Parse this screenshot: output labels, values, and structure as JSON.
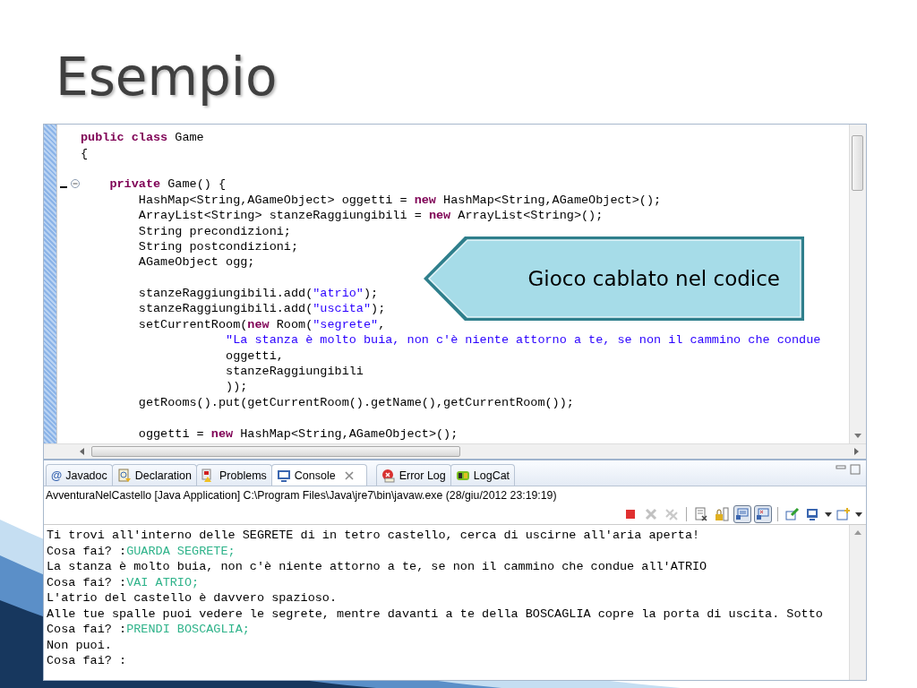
{
  "slide": {
    "title": "Esempio"
  },
  "editor": {
    "lines": [
      {
        "kind": "code",
        "segments": [
          {
            "kind": "keyword",
            "text": "public class"
          },
          {
            "kind": "plain",
            "text": " Game"
          }
        ]
      },
      {
        "kind": "code",
        "segments": [
          {
            "kind": "plain",
            "text": "{"
          }
        ]
      },
      {
        "kind": "blank"
      },
      {
        "kind": "code",
        "expanded": true,
        "caret": true,
        "segments": [
          {
            "kind": "keyword",
            "text": "    private"
          },
          {
            "kind": "plain",
            "text": " Game() {"
          }
        ]
      },
      {
        "kind": "code",
        "segments": [
          {
            "kind": "plain",
            "text": "        HashMap<String,AGameObject> oggetti = "
          },
          {
            "kind": "keyword",
            "text": "new"
          },
          {
            "kind": "plain",
            "text": " HashMap<String,AGameObject>();"
          }
        ]
      },
      {
        "kind": "code",
        "segments": [
          {
            "kind": "plain",
            "text": "        ArrayList<String> stanzeRaggiungibili = "
          },
          {
            "kind": "keyword",
            "text": "new"
          },
          {
            "kind": "plain",
            "text": " ArrayList<String>();"
          }
        ]
      },
      {
        "kind": "code",
        "segments": [
          {
            "kind": "plain",
            "text": "        String precondizioni;"
          }
        ]
      },
      {
        "kind": "code",
        "segments": [
          {
            "kind": "plain",
            "text": "        String postcondizioni;"
          }
        ]
      },
      {
        "kind": "code",
        "segments": [
          {
            "kind": "plain",
            "text": "        AGameObject ogg;"
          }
        ]
      },
      {
        "kind": "blank"
      },
      {
        "kind": "code",
        "segments": [
          {
            "kind": "plain",
            "text": "        stanzeRaggiungibili.add("
          },
          {
            "kind": "string",
            "text": "\"atrio\""
          },
          {
            "kind": "plain",
            "text": ");"
          }
        ]
      },
      {
        "kind": "code",
        "segments": [
          {
            "kind": "plain",
            "text": "        stanzeRaggiungibili.add("
          },
          {
            "kind": "string",
            "text": "\"uscita\""
          },
          {
            "kind": "plain",
            "text": ");"
          }
        ]
      },
      {
        "kind": "code",
        "segments": [
          {
            "kind": "plain",
            "text": "        setCurrentRoom("
          },
          {
            "kind": "keyword",
            "text": "new"
          },
          {
            "kind": "plain",
            "text": " Room("
          },
          {
            "kind": "string",
            "text": "\"segrete\""
          },
          {
            "kind": "plain",
            "text": ","
          }
        ]
      },
      {
        "kind": "code",
        "segments": [
          {
            "kind": "string",
            "text": "                    \"La stanza è molto buia, non c'è niente attorno a te, se non il cammino che condue"
          }
        ]
      },
      {
        "kind": "code",
        "segments": [
          {
            "kind": "plain",
            "text": "                    oggetti,"
          }
        ]
      },
      {
        "kind": "code",
        "segments": [
          {
            "kind": "plain",
            "text": "                    stanzeRaggiungibili"
          }
        ]
      },
      {
        "kind": "code",
        "segments": [
          {
            "kind": "plain",
            "text": "                    ));"
          }
        ]
      },
      {
        "kind": "code",
        "segments": [
          {
            "kind": "plain",
            "text": "        getRooms().put(getCurrentRoom().getName(),getCurrentRoom());"
          }
        ]
      },
      {
        "kind": "blank"
      },
      {
        "kind": "code",
        "segments": [
          {
            "kind": "plain",
            "text": "        oggetti = "
          },
          {
            "kind": "keyword",
            "text": "new"
          },
          {
            "kind": "plain",
            "text": " HashMap<String,AGameObject>();"
          }
        ]
      }
    ]
  },
  "callout": {
    "text": "Gioco cablato nel codice"
  },
  "console_view": {
    "tabs": [
      {
        "glyph": "@",
        "label": "Javadoc",
        "selected": false
      },
      {
        "label": "Declaration",
        "selected": false
      },
      {
        "label": "Problems",
        "selected": false
      },
      {
        "label": "Console",
        "selected": true
      },
      {
        "label": "Error Log",
        "selected": false
      },
      {
        "label": "LogCat",
        "selected": false
      }
    ],
    "process": "AvventuraNelCastello [Java Application] C:\\Program Files\\Java\\jre7\\bin\\javaw.exe (28/giu/2012 23:19:19)",
    "toolbar": [
      {
        "disabled": false,
        "pressed": false
      },
      {
        "disabled": true,
        "pressed": false
      },
      {
        "disabled": true,
        "pressed": false
      },
      {
        "disabled": false,
        "pressed": false
      },
      {
        "disabled": false,
        "pressed": false
      },
      {
        "disabled": false,
        "pressed": true
      },
      {
        "disabled": false,
        "pressed": true
      },
      {
        "disabled": false,
        "pressed": false
      },
      {
        "disabled": false,
        "pressed": false
      },
      {
        "disabled": false,
        "pressed": false
      }
    ],
    "output": [
      {
        "segments": [
          {
            "kind": "output",
            "text": "Ti trovi all'interno delle SEGRETE di in tetro castello, cerca di uscirne all'aria aperta!"
          }
        ]
      },
      {
        "segments": [
          {
            "kind": "output",
            "text": "Cosa fai? :"
          },
          {
            "kind": "input",
            "text": "GUARDA SEGRETE;"
          }
        ]
      },
      {
        "segments": [
          {
            "kind": "output",
            "text": "La stanza è molto buia, non c'è niente attorno a te, se non il cammino che condue all'ATRIO"
          }
        ]
      },
      {
        "segments": [
          {
            "kind": "output",
            "text": "Cosa fai? :"
          },
          {
            "kind": "input",
            "text": "VAI ATRIO;"
          }
        ]
      },
      {
        "segments": [
          {
            "kind": "output",
            "text": "L'atrio del castello è davvero spazioso."
          }
        ]
      },
      {
        "segments": [
          {
            "kind": "output",
            "text": "Alle tue spalle puoi vedere le segrete, mentre davanti a te della BOSCAGLIA copre la porta di uscita. Sotto"
          }
        ]
      },
      {
        "segments": [
          {
            "kind": "output",
            "text": "Cosa fai? :"
          },
          {
            "kind": "input",
            "text": "PRENDI BOSCAGLIA;"
          }
        ]
      },
      {
        "segments": [
          {
            "kind": "output",
            "text": "Non puoi."
          }
        ]
      },
      {
        "segments": [
          {
            "kind": "output",
            "text": "Cosa fai? :"
          }
        ]
      }
    ]
  }
}
